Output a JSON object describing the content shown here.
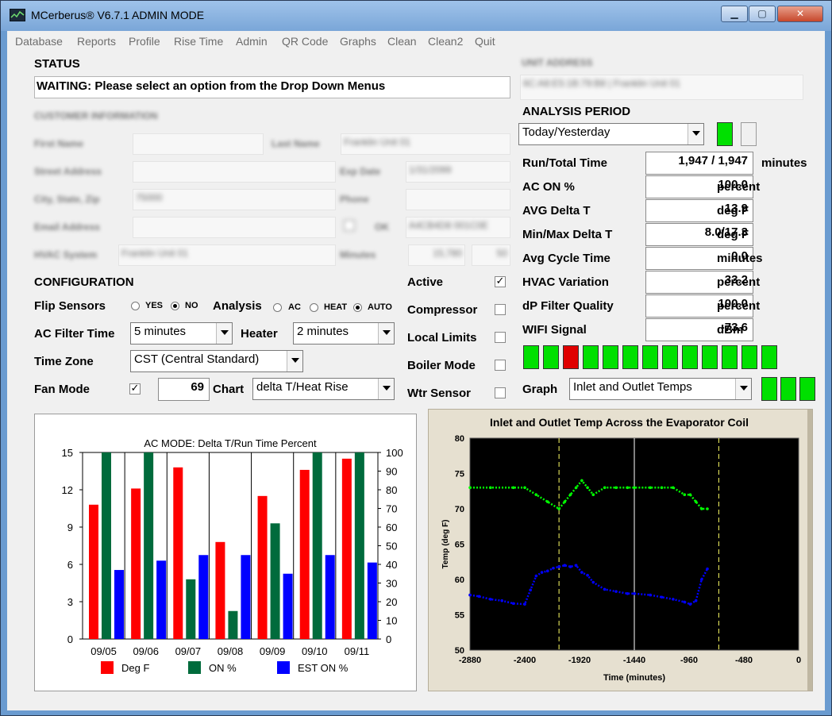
{
  "window": {
    "title": "MCerberus® V6.7.1 ADMIN MODE",
    "min_label": "▁",
    "max_label": "▢",
    "close_label": "✕"
  },
  "menu": [
    "Database",
    "Reports",
    "Profile",
    "Rise Time",
    "Admin",
    "QR Code",
    "Graphs",
    "Clean",
    "Clean2",
    "Quit"
  ],
  "status": {
    "heading": "STATUS",
    "message": "WAITING: Please select an option from the Drop Down Menus"
  },
  "unit_address": {
    "label": "UNIT ADDRESS",
    "value": "6C:A8:E5:1B:79:B8 | Franklin Unit 01"
  },
  "customer": {
    "heading": "CUSTOMER INFORMATION",
    "first_name_label": "First Name",
    "first_name": "",
    "last_name_label": "Last Name",
    "last_name": "Franklin Unit 01",
    "street_label": "Street Address",
    "street": "",
    "exp_date_label": "Exp Date",
    "exp_date": "1/31/2099",
    "city_label": "City, State, Zip",
    "city": "75000",
    "phone_label": "Phone",
    "phone": "",
    "email_label": "Email Address",
    "email": "",
    "ok_label": "OK",
    "ok_value": "A4CB4D8 001C0E",
    "hvac_label": "HVAC System",
    "hvac": "Franklin Unit 01",
    "minutes_label": "Minutes",
    "minutes_1": "15,780",
    "minutes_2": "50"
  },
  "configuration": {
    "heading": "CONFIGURATION",
    "flip_sensors_label": "Flip Sensors",
    "yes_label": "YES",
    "no_label": "NO",
    "analysis_label": "Analysis",
    "ac_label": "AC",
    "heat_label": "HEAT",
    "auto_label": "AUTO",
    "ac_filter_label": "AC Filter Time",
    "ac_filter_value": "5 minutes",
    "heater_label": "Heater",
    "heater_value": "2 minutes",
    "time_zone_label": "Time Zone",
    "time_zone_value": "CST (Central Standard)",
    "fan_mode_label": "Fan Mode",
    "fan_value": "69",
    "chart_label": "Chart",
    "chart_value": "delta T/Heat Rise",
    "active_label": "Active",
    "compressor_label": "Compressor",
    "local_limits_label": "Local Limits",
    "boiler_label": "Boiler Mode",
    "wtr_label": "Wtr Sensor",
    "check_mark": "✓"
  },
  "analysis": {
    "heading": "ANALYSIS PERIOD",
    "period": "Today/Yesterday",
    "rows": [
      {
        "label": "Run/Total Time",
        "value": "1,947 / 1,947",
        "unit": "minutes"
      },
      {
        "label": "AC ON %",
        "value": "100.0",
        "unit": "percent"
      },
      {
        "label": "AVG Delta T",
        "value": "13.9",
        "unit": "deg F"
      },
      {
        "label": "Min/Max Delta T",
        "value": "8.0/17.3",
        "unit": "deg F"
      },
      {
        "label": "Avg Cycle Time",
        "value": "0.0",
        "unit": "minutes"
      },
      {
        "label": "HVAC Variation",
        "value": "33.2",
        "unit": "percent"
      },
      {
        "label": "dP Filter Quality",
        "value": "100.0",
        "unit": "percent"
      },
      {
        "label": "WIFI Signal",
        "value": "-73.6",
        "unit": "dBm"
      }
    ],
    "indicator_row": [
      "green",
      "green",
      "red",
      "green",
      "green",
      "green",
      "green",
      "green",
      "green",
      "green",
      "green",
      "green",
      "green"
    ],
    "graph_label": "Graph",
    "graph_value": "Inlet and Outlet Temps",
    "graph_indicators": [
      "green",
      "green",
      "green"
    ]
  },
  "colors": {
    "red": "#ff0000",
    "on_green": "#006b3c",
    "est_blue": "#0000ff",
    "inlet": "#00ff00",
    "outlet": "#0000ff",
    "marker": "#ffff66"
  },
  "chart_data": [
    {
      "type": "bar",
      "title": "AC MODE: Delta T/Run Time Percent",
      "categories": [
        "09/05",
        "09/06",
        "09/07",
        "09/08",
        "09/09",
        "09/10",
        "09/11"
      ],
      "ylim_left": [
        0,
        15
      ],
      "yticks_left": [
        "0",
        "3",
        "6",
        "9",
        "12",
        "15"
      ],
      "ylim_right": [
        0,
        100
      ],
      "yticks_right": [
        "0",
        "10",
        "20",
        "30",
        "40",
        "50",
        "60",
        "70",
        "80",
        "90",
        "100"
      ],
      "series": [
        {
          "name": "Deg F",
          "axis": "left",
          "color": "#ff0000",
          "values": [
            10.8,
            12.1,
            13.8,
            7.8,
            11.5,
            13.6,
            14.5
          ]
        },
        {
          "name": "ON %",
          "axis": "right",
          "color": "#006b3c",
          "values": [
            100,
            100,
            32,
            15,
            62,
            100,
            100
          ]
        },
        {
          "name": "EST ON %",
          "axis": "right",
          "color": "#0000ff",
          "values": [
            37,
            42,
            45,
            45,
            35,
            45,
            41
          ]
        }
      ],
      "grid": "vertical"
    },
    {
      "type": "scatter",
      "title": "Inlet and Outlet Temp Across the Evaporator Coil",
      "xlabel": "Time (minutes)",
      "ylabel": "Temp (deg F)",
      "xlim": [
        -2880,
        0
      ],
      "ylim": [
        50,
        80
      ],
      "xticks": [
        "-2880",
        "-2400",
        "-1920",
        "-1440",
        "-960",
        "-480",
        "0"
      ],
      "yticks": [
        "50",
        "55",
        "60",
        "65",
        "70",
        "75",
        "80"
      ],
      "markers": [
        {
          "x": -2100,
          "style": "dashed",
          "color": "#ffff66"
        },
        {
          "x": -1440,
          "style": "solid",
          "color": "#ffffff"
        },
        {
          "x": -700,
          "style": "dashed",
          "color": "#ffff66"
        }
      ],
      "series": [
        {
          "name": "Inlet",
          "color": "#00ff00",
          "x": [
            -2880,
            -2700,
            -2500,
            -2400,
            -2300,
            -2200,
            -2100,
            -2050,
            -2000,
            -1950,
            -1900,
            -1850,
            -1800,
            -1700,
            -1600,
            -1500,
            -1440,
            -1300,
            -1200,
            -1100,
            -1000,
            -950,
            -900,
            -850,
            -800
          ],
          "y": [
            73,
            73,
            73,
            73,
            72,
            71,
            70,
            71,
            72,
            73,
            74,
            73,
            72,
            73,
            73,
            73,
            73,
            73,
            73,
            73,
            72,
            72,
            71,
            70,
            70
          ]
        },
        {
          "name": "Outlet",
          "color": "#0000ff",
          "x": [
            -2880,
            -2800,
            -2700,
            -2600,
            -2500,
            -2400,
            -2350,
            -2300,
            -2250,
            -2200,
            -2150,
            -2100,
            -2050,
            -2000,
            -1950,
            -1900,
            -1850,
            -1800,
            -1700,
            -1600,
            -1500,
            -1440,
            -1300,
            -1200,
            -1100,
            -1000,
            -950,
            -900,
            -850,
            -800
          ],
          "y": [
            57.8,
            57.6,
            57.2,
            57.0,
            56.6,
            56.5,
            58.5,
            60.5,
            61,
            61.2,
            61.6,
            61.8,
            62,
            61.8,
            62,
            61,
            60.6,
            59.6,
            58.6,
            58.3,
            58,
            58,
            57.8,
            57.5,
            57.2,
            56.8,
            56.5,
            57,
            60,
            61.5
          ]
        }
      ]
    }
  ]
}
